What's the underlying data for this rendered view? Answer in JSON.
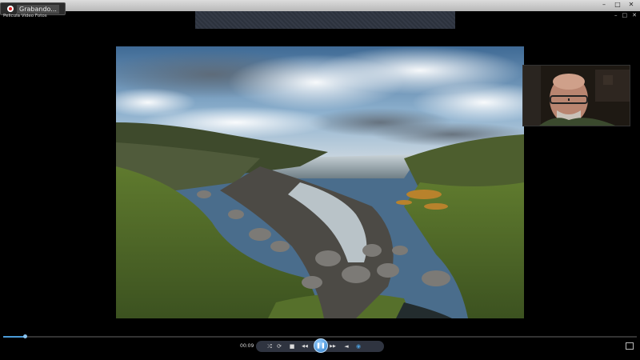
{
  "recording": {
    "label": "Grabando...",
    "icon": "record-icon"
  },
  "window": {
    "title": "Pelicula Video Fotos",
    "controls": [
      "–",
      "□",
      "✕"
    ]
  },
  "player": {
    "time": "00:09",
    "progress_percent": 3.4,
    "buttons": {
      "shuffle": "⤮",
      "repeat": "⟳",
      "stop": "■",
      "rewind": "◀◀",
      "play_pause": "❚❚",
      "forward": "▶▶",
      "mute": "◄",
      "volume": "◉"
    }
  },
  "colors": {
    "accent": "#4a9bd8",
    "record": "#dd2222"
  }
}
